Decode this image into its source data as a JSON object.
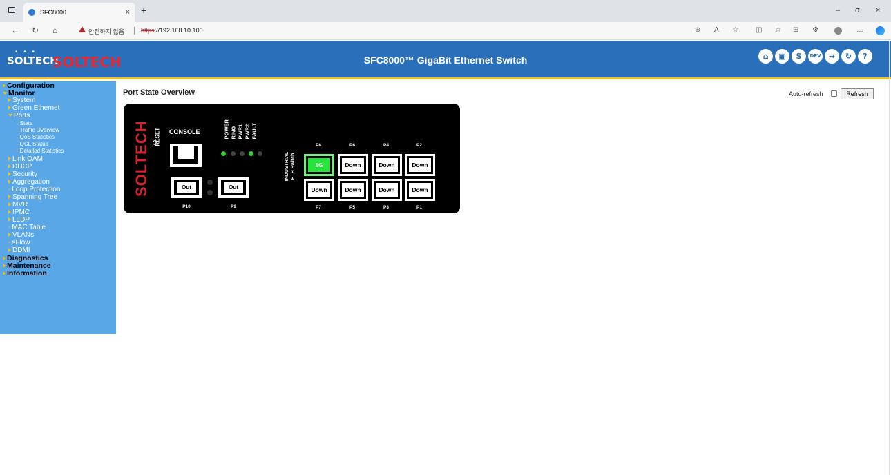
{
  "browser": {
    "tab_title": "SFC8000",
    "tab_close": "×",
    "new_tab": "+",
    "insecure_label": "안전하지 않음",
    "url_scheme": "https",
    "url_rest": "://192.168.10.100",
    "window_controls": [
      "–",
      "σ",
      "×"
    ]
  },
  "header": {
    "logo_small": "SOLTECH",
    "logo_dots": "• • •",
    "logo_red": "SOLTECH",
    "title": "SFC8000™ GigaBit Ethernet Switch",
    "icons": [
      {
        "name": "home-icon",
        "glyph": "⌂"
      },
      {
        "name": "save-icon",
        "glyph": "▣"
      },
      {
        "name": "ring-icon",
        "glyph": "S"
      },
      {
        "name": "dev-icon",
        "glyph": "DEV"
      },
      {
        "name": "logout-icon",
        "glyph": "→"
      },
      {
        "name": "refresh-icon",
        "glyph": "↻"
      },
      {
        "name": "help-icon",
        "glyph": "?"
      }
    ],
    "accent": "#f0c020",
    "bg": "#2a6fba"
  },
  "sidebar": {
    "items": [
      {
        "label": "Configuration",
        "level": 0,
        "arrow": "right"
      },
      {
        "label": "Monitor",
        "level": 0,
        "arrow": "down"
      },
      {
        "label": "System",
        "level": 1,
        "arrow": "right"
      },
      {
        "label": "Green Ethernet",
        "level": 1,
        "arrow": "right"
      },
      {
        "label": "Ports",
        "level": 1,
        "arrow": "down"
      },
      {
        "label": "State",
        "level": 2,
        "arrow": "dash"
      },
      {
        "label": "Traffic Overview",
        "level": 2,
        "arrow": "dash"
      },
      {
        "label": "QoS Statistics",
        "level": 2,
        "arrow": "dash"
      },
      {
        "label": "QCL Status",
        "level": 2,
        "arrow": "dash"
      },
      {
        "label": "Detailed Statistics",
        "level": 2,
        "arrow": "dash"
      },
      {
        "label": "Link OAM",
        "level": 1,
        "arrow": "right"
      },
      {
        "label": "DHCP",
        "level": 1,
        "arrow": "right"
      },
      {
        "label": "Security",
        "level": 1,
        "arrow": "right"
      },
      {
        "label": "Aggregation",
        "level": 1,
        "arrow": "right"
      },
      {
        "label": "Loop Protection",
        "level": 1,
        "arrow": "dash"
      },
      {
        "label": "Spanning Tree",
        "level": 1,
        "arrow": "right"
      },
      {
        "label": "MVR",
        "level": 1,
        "arrow": "right"
      },
      {
        "label": "IPMC",
        "level": 1,
        "arrow": "right"
      },
      {
        "label": "LLDP",
        "level": 1,
        "arrow": "right"
      },
      {
        "label": "MAC Table",
        "level": 1,
        "arrow": "dash"
      },
      {
        "label": "VLANs",
        "level": 1,
        "arrow": "right"
      },
      {
        "label": "sFlow",
        "level": 1,
        "arrow": "dash"
      },
      {
        "label": "DDMI",
        "level": 1,
        "arrow": "right"
      },
      {
        "label": "Diagnostics",
        "level": 0,
        "arrow": "right"
      },
      {
        "label": "Maintenance",
        "level": 0,
        "arrow": "right"
      },
      {
        "label": "Information",
        "level": 0,
        "arrow": "right"
      }
    ]
  },
  "main": {
    "title": "Port State Overview",
    "auto_refresh_label": "Auto-refresh",
    "refresh_button": "Refresh"
  },
  "panel": {
    "brand": "SOLTECH",
    "reset_label": "RESET",
    "console_label": "CONSOLE",
    "industrial": [
      "INDUSTRIAL",
      "ETH Switch"
    ],
    "leds": [
      {
        "label": "POWER",
        "on": true
      },
      {
        "label": "RING",
        "on": false
      },
      {
        "label": "PWR1",
        "on": false
      },
      {
        "label": "PWR2",
        "on": true
      },
      {
        "label": "FAULT",
        "on": false
      }
    ],
    "sfp_ports": [
      {
        "port": "P10",
        "state": "Out"
      },
      {
        "port": "P9",
        "state": "Out"
      }
    ],
    "top_ports": [
      {
        "port": "P8",
        "state": "1G",
        "up": true
      },
      {
        "port": "P6",
        "state": "Down",
        "up": false
      },
      {
        "port": "P4",
        "state": "Down",
        "up": false
      },
      {
        "port": "P2",
        "state": "Down",
        "up": false
      }
    ],
    "bottom_ports": [
      {
        "port": "P7",
        "state": "Down",
        "up": false
      },
      {
        "port": "P5",
        "state": "Down",
        "up": false
      },
      {
        "port": "P3",
        "state": "Down",
        "up": false
      },
      {
        "port": "P1",
        "state": "Down",
        "up": false
      }
    ],
    "link_up_color": "#27e43c"
  }
}
